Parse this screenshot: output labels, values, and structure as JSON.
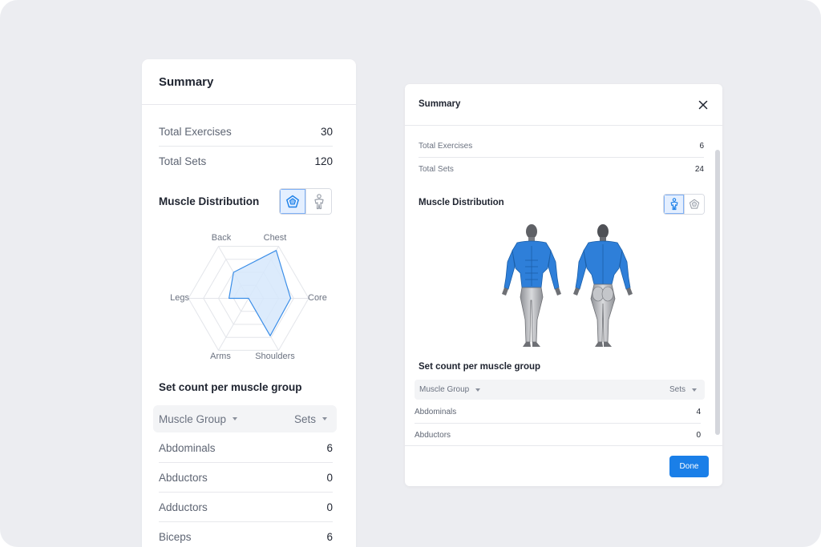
{
  "left_panel": {
    "title": "Summary",
    "stats": [
      {
        "label": "Total Exercises",
        "value": "30"
      },
      {
        "label": "Total Sets",
        "value": "120"
      }
    ],
    "distribution_title": "Muscle Distribution",
    "radar_labels": {
      "back": "Back",
      "chest": "Chest",
      "core": "Core",
      "shoulders": "Shoulders",
      "arms": "Arms",
      "legs": "Legs"
    },
    "set_count_title": "Set count per muscle group",
    "table_headers": {
      "group": "Muscle Group",
      "sets": "Sets"
    },
    "rows": [
      {
        "group": "Abdominals",
        "sets": "6"
      },
      {
        "group": "Abductors",
        "sets": "0"
      },
      {
        "group": "Adductors",
        "sets": "0"
      },
      {
        "group": "Biceps",
        "sets": "6"
      }
    ]
  },
  "dialog": {
    "title": "Summary",
    "stats": [
      {
        "label": "Total Exercises",
        "value": "6"
      },
      {
        "label": "Total Sets",
        "value": "24"
      }
    ],
    "distribution_title": "Muscle Distribution",
    "set_count_title": "Set count per muscle group",
    "table_headers": {
      "group": "Muscle Group",
      "sets": "Sets"
    },
    "rows": [
      {
        "group": "Abdominals",
        "sets": "4"
      },
      {
        "group": "Abductors",
        "sets": "0"
      }
    ],
    "done_label": "Done"
  },
  "icons": {
    "radar_toggle": "radar-chart-icon",
    "body_toggle": "body-map-icon",
    "close": "close-icon",
    "sort": "caret-down-icon"
  },
  "colors": {
    "accent": "#1a7fe8",
    "muscle_highlight": "#2e7fd9",
    "radar_fill": "#d6e7fb",
    "radar_stroke": "#3b8ee8"
  }
}
